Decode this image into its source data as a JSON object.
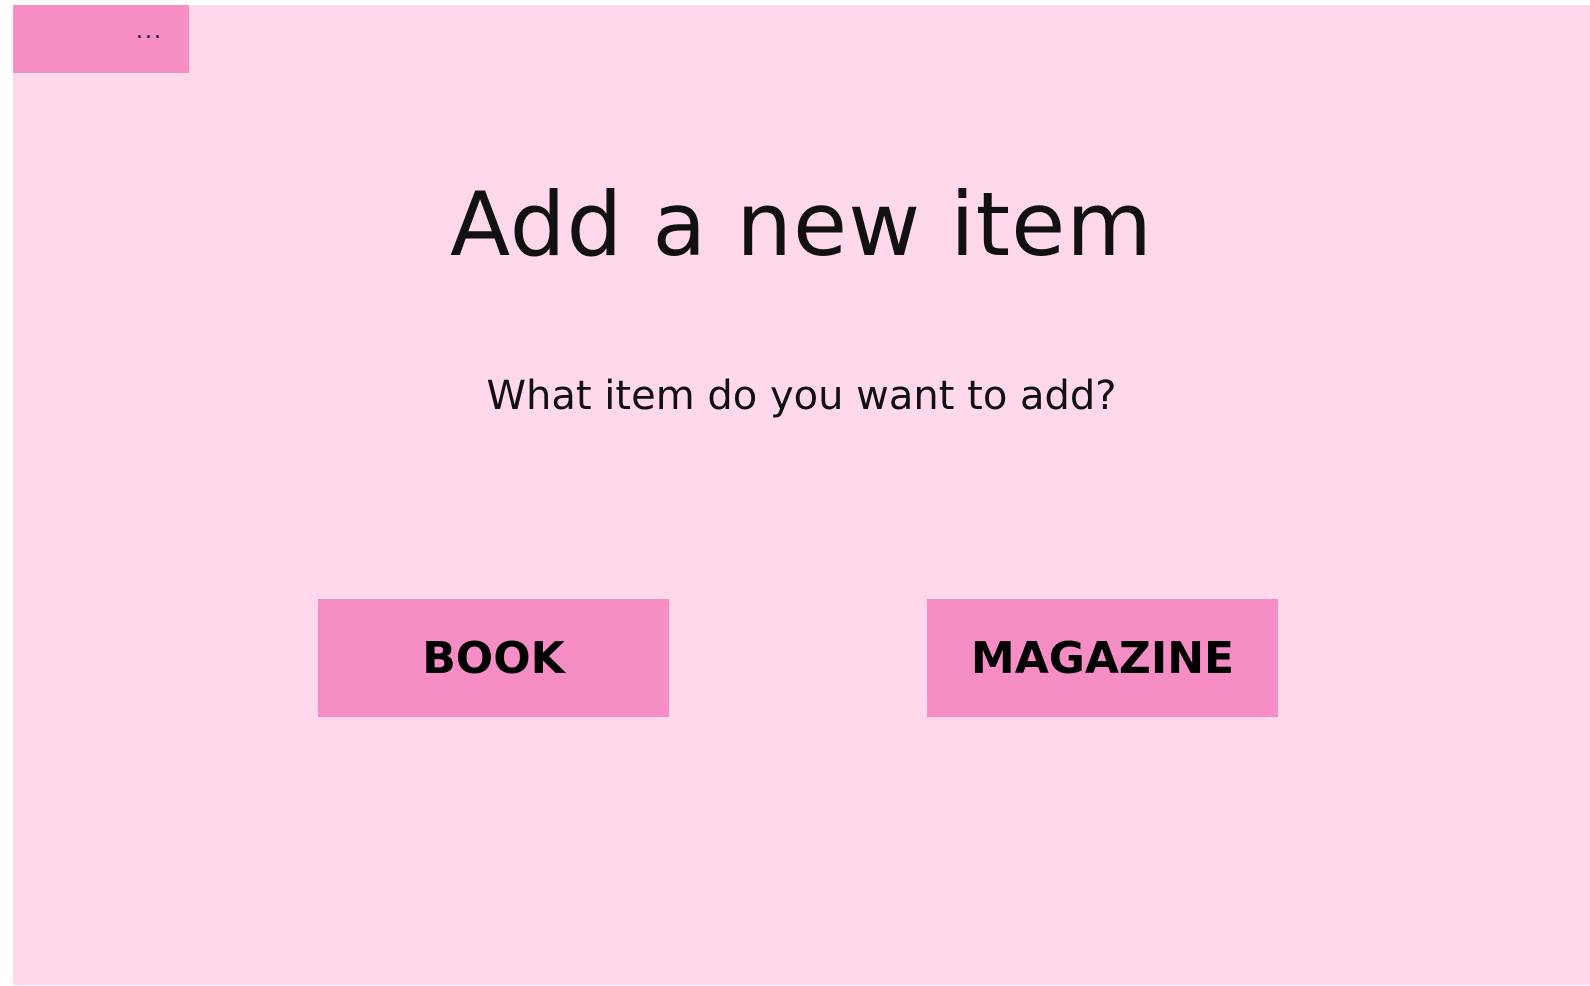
{
  "toolbar": {
    "more_glyph": "..."
  },
  "main": {
    "title": "Add a new item",
    "prompt": "What item do you want to add?",
    "buttons": {
      "book": "BOOK",
      "magazine": "MAGAZINE"
    }
  },
  "colors": {
    "background": "#ffd8eb",
    "accent": "#f78dc5",
    "text": "#111111"
  },
  "icons": {
    "more": "more-options-icon"
  }
}
